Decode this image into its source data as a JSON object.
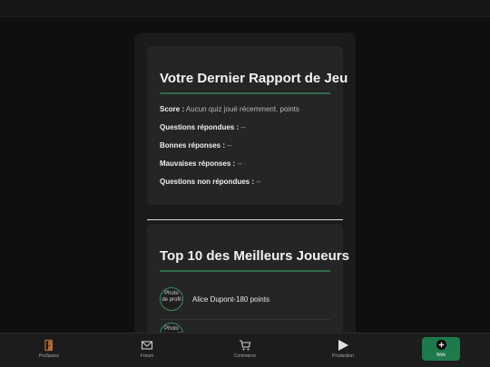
{
  "report": {
    "title": "Votre Dernier Rapport de Jeu",
    "stats": [
      {
        "label": "Score :",
        "value": "Aucun quiz joué récemment. points"
      },
      {
        "label": "Questions répondues :",
        "value": "--"
      },
      {
        "label": "Bonnes réponses :",
        "value": "--"
      },
      {
        "label": "Mauvaises réponses :",
        "value": "--"
      },
      {
        "label": "Questions non répondues :",
        "value": "--"
      }
    ]
  },
  "leaderboard": {
    "title": "Top 10 des Meilleurs Joueurs",
    "players": [
      {
        "avatar_alt": "Photo de profil",
        "entry": "Alice Dupont-180 points"
      },
      {
        "avatar_alt": "Photo de profil",
        "entry": ""
      }
    ]
  },
  "nav": {
    "items": [
      {
        "label": "ProSpace",
        "icon": "door-icon"
      },
      {
        "label": "Forum",
        "icon": "envelope-icon"
      },
      {
        "label": "Commerce",
        "icon": "cart-icon"
      },
      {
        "label": "Production",
        "icon": "play-icon"
      },
      {
        "label": "Web",
        "icon": "globe-icon"
      }
    ]
  },
  "colors": {
    "accent": "#1e7a4c",
    "rule": "#2f6b4a",
    "background": "#0f0f0f",
    "card": "#252525"
  }
}
